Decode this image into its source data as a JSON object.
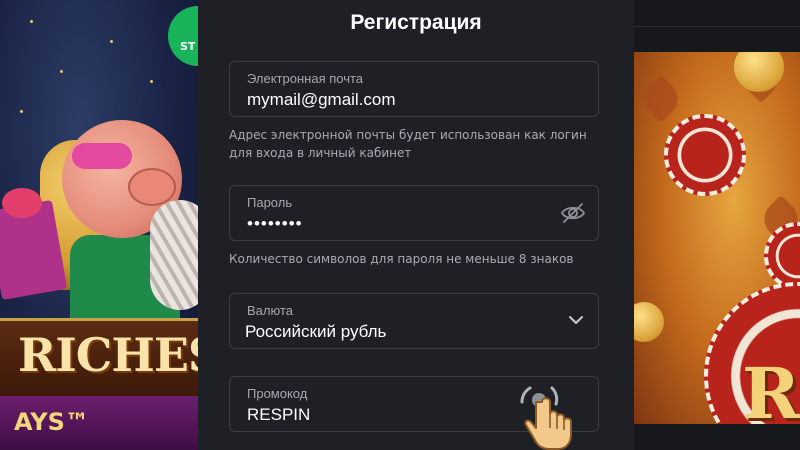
{
  "form": {
    "title": "Регистрация",
    "email": {
      "label": "Электронная почта",
      "value": "mymail@gmail.com"
    },
    "email_hint_line1": "Адрес электронной почты будет использован как логин",
    "email_hint_line2": "для входа в личный кабинет",
    "password": {
      "label": "Пароль",
      "value": "••••••••",
      "visibility_icon": "eye-slash-icon"
    },
    "password_hint": "Количество символов для пароля не меньше 8 знаков",
    "currency": {
      "label": "Валюта",
      "value": "Российский рубль",
      "dropdown_icon": "chevron-down-icon"
    },
    "promo": {
      "label": "Промокод",
      "value": "RESPIN"
    }
  },
  "banners": {
    "left_logo_text": "RICHES",
    "left_sub_text": "AYS™",
    "left_badge_text": "ST"
  },
  "colors": {
    "panel_bg": "#1e2025",
    "field_border": "#3a3d45",
    "label_text": "#a5a8b0",
    "value_text": "#ffffff"
  }
}
